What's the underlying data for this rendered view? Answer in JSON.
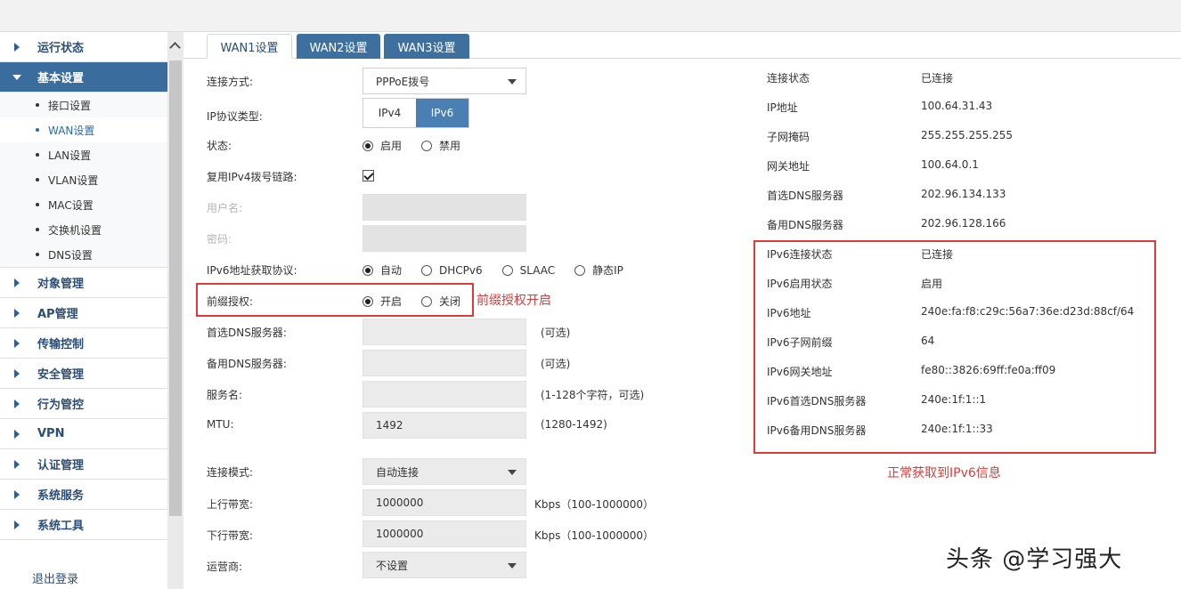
{
  "sidebar": {
    "groups_top": [
      {
        "label": "运行状态",
        "active": false
      },
      {
        "label": "基本设置",
        "active": true
      }
    ],
    "sub_items": [
      {
        "label": "接口设置"
      },
      {
        "label": "WAN设置"
      },
      {
        "label": "LAN设置"
      },
      {
        "label": "VLAN设置"
      },
      {
        "label": "MAC设置"
      },
      {
        "label": "交换机设置"
      },
      {
        "label": "DNS设置"
      }
    ],
    "groups_bottom": [
      {
        "label": "对象管理"
      },
      {
        "label": "AP管理"
      },
      {
        "label": "传输控制"
      },
      {
        "label": "安全管理"
      },
      {
        "label": "行为管控"
      },
      {
        "label": "VPN"
      },
      {
        "label": "认证管理"
      },
      {
        "label": "系统服务"
      },
      {
        "label": "系统工具"
      }
    ],
    "logout": "退出登录"
  },
  "tabs": [
    "WAN1设置",
    "WAN2设置",
    "WAN3设置"
  ],
  "form": {
    "conn_type_label": "连接方式:",
    "conn_type_value": "PPPoE拨号",
    "ip_proto_label": "IP协议类型:",
    "ip_proto_opts": [
      "IPv4",
      "IPv6"
    ],
    "status_label": "状态:",
    "status_opts": [
      "启用",
      "禁用"
    ],
    "reuse_label": "复用IPv4拨号链路:",
    "username_label": "用户名:",
    "password_label": "密码:",
    "ipv6_proto_label": "IPv6地址获取协议:",
    "ipv6_proto_opts": [
      "自动",
      "DHCPv6",
      "SLAAC",
      "静态IP"
    ],
    "prefix_label": "前缀授权:",
    "prefix_opts": [
      "开启",
      "关闭"
    ],
    "dns1_label": "首选DNS服务器:",
    "dns1_hint": "(可选)",
    "dns2_label": "备用DNS服务器:",
    "dns2_hint": "(可选)",
    "service_label": "服务名:",
    "service_hint": "(1-128个字符，可选)",
    "mtu_label": "MTU:",
    "mtu_value": "1492",
    "mtu_hint": "(1280-1492)",
    "conn_mode_label": "连接模式:",
    "conn_mode_value": "自动连接",
    "up_bw_label": "上行带宽:",
    "up_bw_value": "1000000",
    "up_bw_hint": "Kbps（100-1000000）",
    "down_bw_label": "下行带宽:",
    "down_bw_value": "1000000",
    "down_bw_hint": "Kbps（100-1000000）",
    "isp_label": "运营商:",
    "isp_value": "不设置"
  },
  "info": [
    {
      "label": "连接状态",
      "value": "已连接"
    },
    {
      "label": "IP地址",
      "value": "100.64.31.43"
    },
    {
      "label": "子网掩码",
      "value": "255.255.255.255"
    },
    {
      "label": "网关地址",
      "value": "100.64.0.1"
    },
    {
      "label": "首选DNS服务器",
      "value": "202.96.134.133"
    },
    {
      "label": "备用DNS服务器",
      "value": "202.96.128.166"
    },
    {
      "label": "IPv6连接状态",
      "value": "已连接"
    },
    {
      "label": "IPv6启用状态",
      "value": "启用"
    },
    {
      "label": "IPv6地址",
      "value": "240e:fa:f8:c29c:56a7:36e:d23d:88cf/64"
    },
    {
      "label": "IPv6子网前缀",
      "value": "64"
    },
    {
      "label": "IPv6网关地址",
      "value": "fe80::3826:69ff:fe0a:ff09"
    },
    {
      "label": "IPv6首选DNS服务器",
      "value": "240e:1f:1::1"
    },
    {
      "label": "IPv6备用DNS服务器",
      "value": "240e:1f:1::33"
    }
  ],
  "annotations": {
    "prefix_note": "前缀授权开启",
    "ipv6_note": "正常获取到IPv6信息"
  },
  "watermark": "头条 @学习强大",
  "colors": {
    "accent": "#3a6c9e",
    "annotation": "#e03a3a"
  }
}
